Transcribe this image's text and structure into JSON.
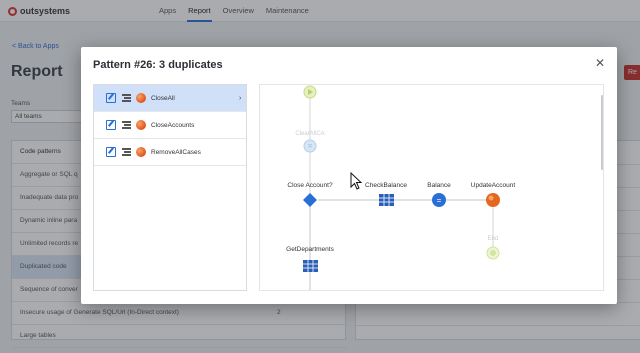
{
  "app": {
    "logo_text": "outsystems"
  },
  "top_nav": [
    {
      "label": "Apps"
    },
    {
      "label": "Report",
      "active": true
    },
    {
      "label": "Overview"
    },
    {
      "label": "Maintenance"
    }
  ],
  "back_link": "< Back to Apps",
  "page_title": "Report",
  "report_button": "Re",
  "filter": {
    "label": "Teams",
    "value": "All teams"
  },
  "code_patterns": {
    "header": "Code patterns",
    "rows": [
      {
        "label": "Aggregate or SQL q",
        "num": ""
      },
      {
        "label": "Inadequate data pro",
        "num": ""
      },
      {
        "label": "Dynamic inline para",
        "num": ""
      },
      {
        "label": "Unlimited records re",
        "num": ""
      },
      {
        "label": "Duplicated code",
        "num": "",
        "active": true
      },
      {
        "label": "Sequence of conver",
        "num": ""
      },
      {
        "label": "Insecure usage of Generate SQL/Url (In-Direct context)",
        "num": "2"
      },
      {
        "label": "Large tables",
        "num": ""
      }
    ]
  },
  "modal": {
    "title": "Pattern #26: 3 duplicates",
    "close_icon": "close-icon",
    "items": [
      {
        "label": "CloseAll",
        "selected": true
      },
      {
        "label": "CloseAccounts",
        "selected": false
      },
      {
        "label": "RemoveAllCases",
        "selected": false
      }
    ],
    "flow": {
      "nodes": [
        {
          "id": "start",
          "label": "",
          "kind": "start"
        },
        {
          "id": "assign",
          "label": "ClearAllCA",
          "kind": "assign-faded"
        },
        {
          "id": "if",
          "label": "Close Account?",
          "kind": "if"
        },
        {
          "id": "check",
          "label": "CheckBalance",
          "kind": "table"
        },
        {
          "id": "balance",
          "label": "Balance",
          "kind": "assign"
        },
        {
          "id": "update",
          "label": "UpdateAccount",
          "kind": "action"
        },
        {
          "id": "getdep",
          "label": "GetDepartments",
          "kind": "table"
        },
        {
          "id": "end",
          "label": "End",
          "kind": "end"
        }
      ]
    }
  },
  "colors": {
    "accent": "#2a6fd6",
    "brand": "#d9322f",
    "selected_row": "#cfe0f8",
    "node_blue": "#2a6fd6",
    "node_orange": "#e4661f",
    "node_green": "#bcd96a"
  }
}
